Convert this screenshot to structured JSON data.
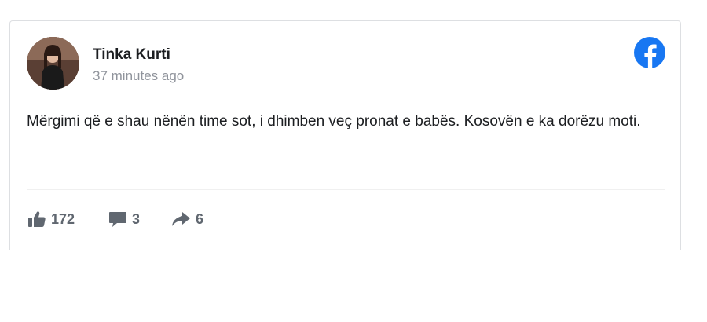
{
  "post": {
    "author_name": "Tinka Kurti",
    "timestamp": "37 minutes ago",
    "text": "Mërgimi që e shau nënën time sot, i dhimben veç pronat e babës. Kosovën e ka dorëzu moti."
  },
  "stats": {
    "likes": "172",
    "comments": "3",
    "shares": "6"
  },
  "icons": {
    "brand": "facebook-icon",
    "like": "thumbs-up-icon",
    "comment": "speech-bubble-icon",
    "share": "share-arrow-icon"
  },
  "colors": {
    "facebook_blue": "#1877f2",
    "stat_gray": "#606770",
    "timestamp_gray": "#90949c",
    "text": "#1c1e21"
  }
}
